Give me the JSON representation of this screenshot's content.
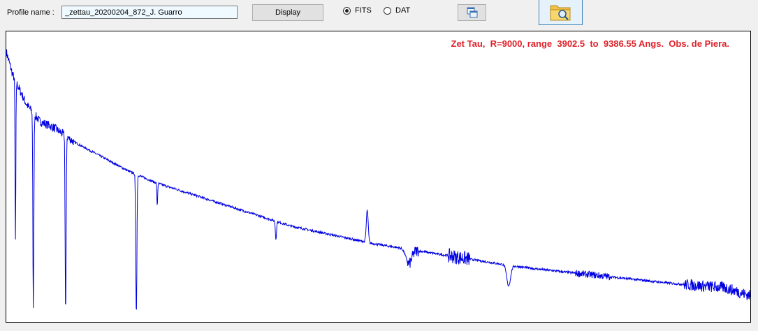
{
  "toolbar": {
    "profile_label": "Profile name :",
    "profile_value": "_zettau_20200204_872_J. Guarro",
    "display_label": "Display",
    "radio_fits": "FITS",
    "radio_dat": "DAT",
    "selected_format": "FITS",
    "icons": {
      "copy": "copy-windows-icon",
      "open": "folder-search-icon"
    }
  },
  "plot": {
    "title": "Zet Tau,  R=9000, range  3902.5  to  9386.55 Angs.  Obs. de Piera.",
    "line_color": "#0000e0",
    "title_color": "#e0212b"
  },
  "chart_data": {
    "type": "line",
    "xlim": [
      3902.5,
      9386.55
    ],
    "ylim": [
      0,
      1
    ],
    "grid": false,
    "continuum": [
      [
        3902.5,
        0.93
      ],
      [
        3950,
        0.85
      ],
      [
        4050,
        0.75
      ],
      [
        4150,
        0.69
      ],
      [
        4250,
        0.67
      ],
      [
        4400,
        0.62
      ],
      [
        4600,
        0.57
      ],
      [
        4800,
        0.52
      ],
      [
        5000,
        0.48
      ],
      [
        5200,
        0.45
      ],
      [
        5400,
        0.42
      ],
      [
        5600,
        0.39
      ],
      [
        5800,
        0.36
      ],
      [
        6000,
        0.33
      ],
      [
        6200,
        0.31
      ],
      [
        6400,
        0.29
      ],
      [
        6600,
        0.27
      ],
      [
        6800,
        0.255
      ],
      [
        7000,
        0.24
      ],
      [
        7200,
        0.225
      ],
      [
        7400,
        0.21
      ],
      [
        7600,
        0.195
      ],
      [
        7800,
        0.183
      ],
      [
        8000,
        0.173
      ],
      [
        8200,
        0.163
      ],
      [
        8400,
        0.153
      ],
      [
        8600,
        0.143
      ],
      [
        8800,
        0.133
      ],
      [
        9000,
        0.125
      ],
      [
        9200,
        0.118
      ],
      [
        9386.55,
        0.09
      ]
    ],
    "lines": [
      {
        "center": 3970,
        "depth": 0.55,
        "width": 4
      },
      {
        "center": 4102,
        "depth": 0.68,
        "width": 5
      },
      {
        "center": 4340,
        "depth": 0.62,
        "width": 5
      },
      {
        "center": 4861,
        "depth": 0.48,
        "width": 6
      },
      {
        "center": 5015,
        "depth": 0.08,
        "width": 4
      },
      {
        "center": 5890,
        "depth": 0.06,
        "width": 6
      },
      {
        "center": 6870,
        "depth": 0.05,
        "width": 30
      },
      {
        "center": 7605,
        "depth": 0.07,
        "width": 20
      }
    ],
    "emission": [
      {
        "center": 6563,
        "height": 0.11,
        "width": 10
      }
    ],
    "noise_bands": [
      [
        6860,
        6940,
        0.02
      ],
      [
        7160,
        7320,
        0.025
      ],
      [
        8100,
        8350,
        0.012
      ],
      [
        8900,
        9386.55,
        0.02
      ]
    ]
  }
}
